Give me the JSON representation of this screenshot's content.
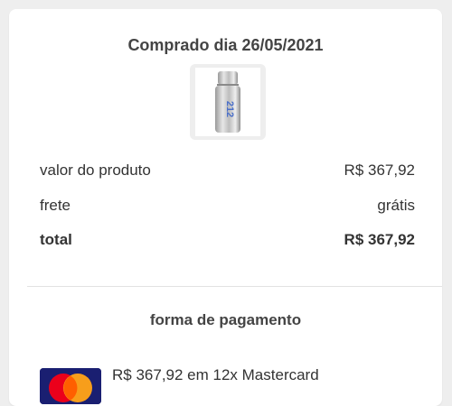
{
  "purchase": {
    "title": "Comprado dia 26/05/2021",
    "product_image_icon": "perfume-bottle-icon",
    "product_label": "212"
  },
  "summary": {
    "rows": [
      {
        "label": "valor do produto",
        "value": "R$ 367,92"
      },
      {
        "label": "frete",
        "value": "grátis"
      },
      {
        "label": "total",
        "value": "R$ 367,92"
      }
    ]
  },
  "payment": {
    "title": "forma de pagamento",
    "method_text": "R$ 367,92 em 12x Mastercard",
    "card_brand_icon": "mastercard-icon"
  },
  "colors": {
    "background": "#eeeeee",
    "card": "#ffffff",
    "text": "#333333",
    "divider": "#e2e2e2"
  }
}
